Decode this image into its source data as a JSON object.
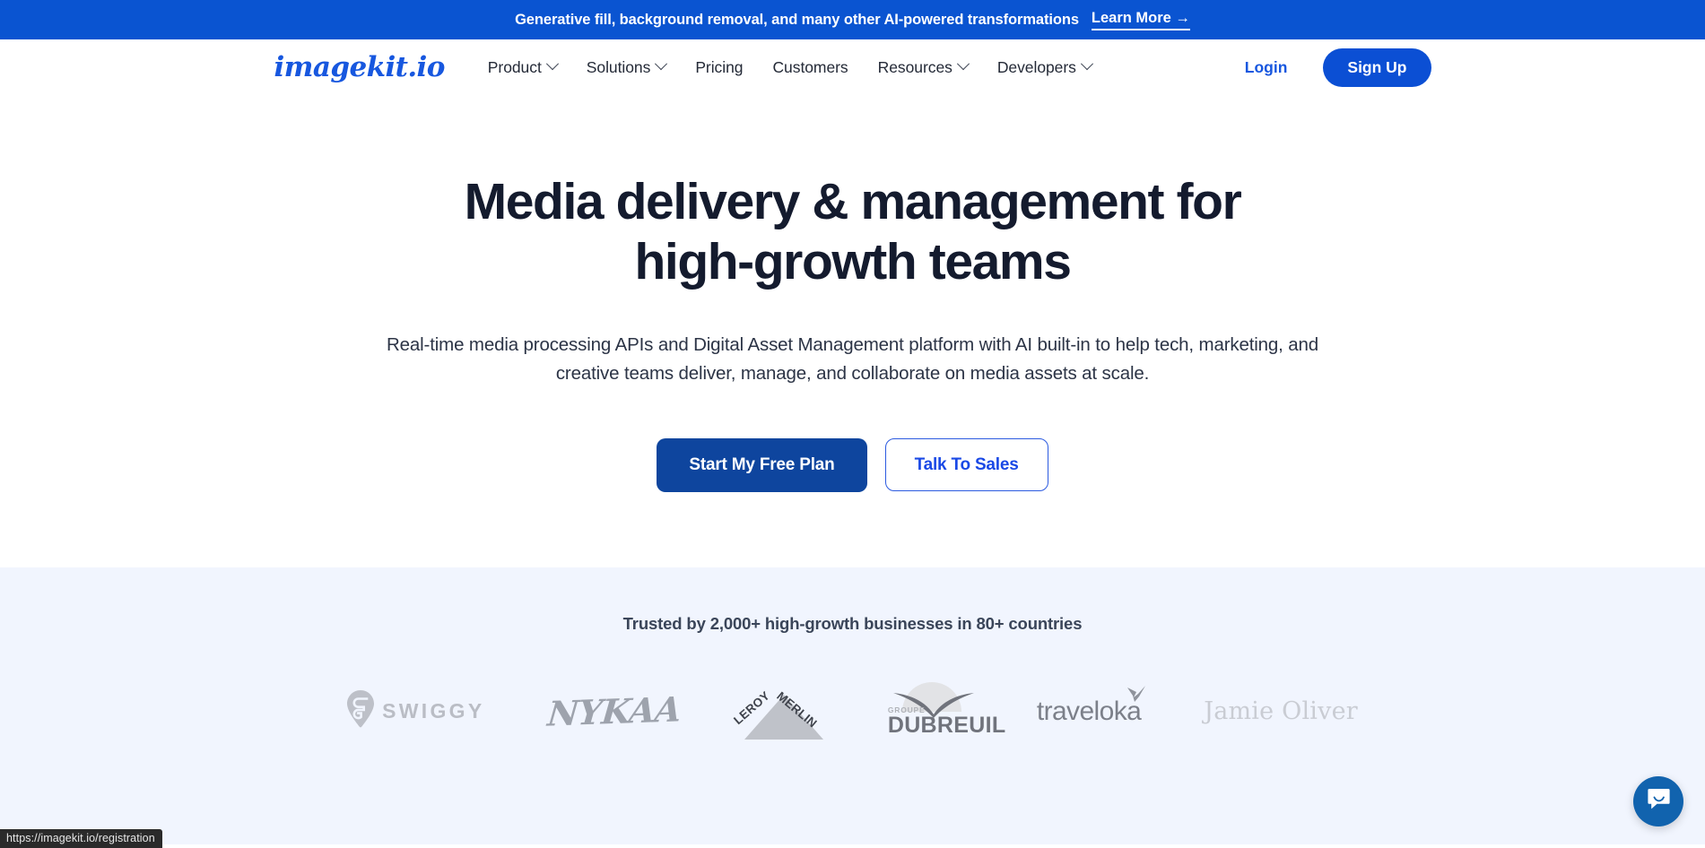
{
  "announcement": {
    "text": "Generative fill, background removal, and many other AI-powered transformations",
    "link_label": "Learn More →",
    "background": "#0A54D1"
  },
  "header": {
    "logo": "imagekit.io",
    "logo_color": "#1757DF",
    "nav": [
      {
        "label": "Product",
        "has_dropdown": true
      },
      {
        "label": "Solutions",
        "has_dropdown": true
      },
      {
        "label": "Pricing",
        "has_dropdown": false
      },
      {
        "label": "Customers",
        "has_dropdown": false
      },
      {
        "label": "Resources",
        "has_dropdown": true
      },
      {
        "label": "Developers",
        "has_dropdown": true
      }
    ],
    "login_label": "Login",
    "signup_label": "Sign Up",
    "signup_color": "#0B4FD4"
  },
  "hero": {
    "title_line1": "Media delivery & management for",
    "title_line2": "high-growth teams",
    "subtitle": "Real-time media processing APIs and Digital Asset Management platform with AI built-in to help tech, marketing, and creative teams deliver, manage, and collaborate on media assets at scale.",
    "primary_cta": "Start My Free Plan",
    "secondary_cta": "Talk To Sales",
    "primary_color": "#0E459E",
    "secondary_color": "#1A49E6"
  },
  "trusted": {
    "heading": "Trusted by 2,000+ high-growth businesses in 80+ countries",
    "background": "#F1F5FE",
    "logos": [
      {
        "name": "Swiggy",
        "wordmark": "SWIGGY",
        "icon": "map-pin-icon"
      },
      {
        "name": "Nykaa",
        "wordmark": "NYKAA",
        "icon": "none"
      },
      {
        "name": "Leroy Merlin",
        "wordmark_part1": "LEROY",
        "wordmark_part2": "MERLIN",
        "icon": "triangle-icon"
      },
      {
        "name": "Groupe Dubreuil",
        "wordmark_small": "GROUPE",
        "wordmark": "DUBREUIL",
        "icon": "wing-arc-icon"
      },
      {
        "name": "Traveloka",
        "wordmark": "traveloka",
        "icon": "origami-bird-icon"
      },
      {
        "name": "Jamie Oliver",
        "wordmark": "Jamie Oliver",
        "icon": "none"
      }
    ]
  },
  "chat": {
    "label": "chat-launcher",
    "color": "#1163AE"
  },
  "status_bar": {
    "url": "https://imagekit.io/registration"
  }
}
